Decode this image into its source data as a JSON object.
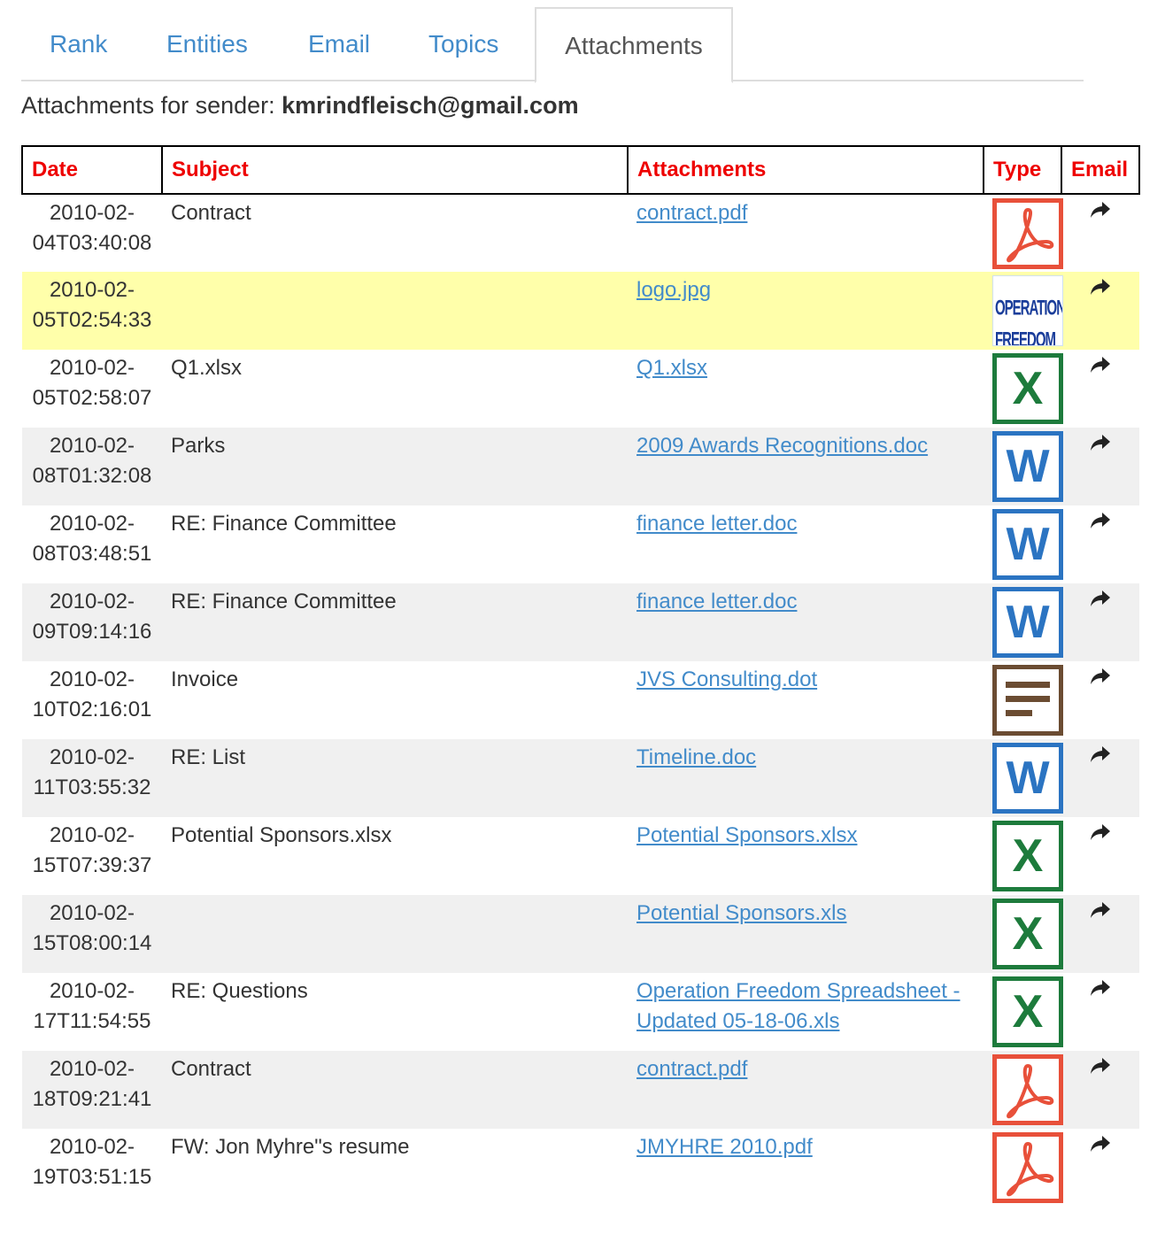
{
  "tabs": [
    {
      "label": "Rank"
    },
    {
      "label": "Entities"
    },
    {
      "label": "Email"
    },
    {
      "label": "Topics"
    },
    {
      "label": "Attachments",
      "active": true
    }
  ],
  "sender": {
    "prefix": "Attachments for sender:",
    "email": "kmrindfleisch@gmail.com"
  },
  "table": {
    "headers": {
      "date": "Date",
      "subject": "Subject",
      "attachments": "Attachments",
      "type": "Type",
      "email": "Email"
    },
    "rows": [
      {
        "date_line1": "2010-02-",
        "date_line2": "04T03:40:08",
        "subject": "Contract",
        "attachment": "contract.pdf",
        "type_icon": "pdf-icon"
      },
      {
        "date_line1": "2010-02-",
        "date_line2": "05T02:54:33",
        "subject": "",
        "attachment": "logo.jpg",
        "type_icon": "image-thumbnail",
        "thumb_text": [
          "OPERATION",
          "FREEDOM"
        ],
        "highlighted": true
      },
      {
        "date_line1": "2010-02-",
        "date_line2": "05T02:58:07",
        "subject": "Q1.xlsx",
        "attachment": "Q1.xlsx",
        "type_icon": "excel-icon"
      },
      {
        "date_line1": "2010-02-",
        "date_line2": "08T01:32:08",
        "subject": "Parks",
        "attachment": "2009 Awards Recognitions.doc",
        "type_icon": "word-icon"
      },
      {
        "date_line1": "2010-02-",
        "date_line2": "08T03:48:51",
        "subject": "RE: Finance Committee",
        "attachment": "finance letter.doc",
        "type_icon": "word-icon"
      },
      {
        "date_line1": "2010-02-",
        "date_line2": "09T09:14:16",
        "subject": "RE: Finance Committee",
        "attachment": "finance letter.doc",
        "type_icon": "word-icon"
      },
      {
        "date_line1": "2010-02-",
        "date_line2": "10T02:16:01",
        "subject": "Invoice",
        "attachment": "JVS Consulting.dot",
        "type_icon": "text-document-icon"
      },
      {
        "date_line1": "2010-02-",
        "date_line2": "11T03:55:32",
        "subject": "RE: List",
        "attachment": "Timeline.doc",
        "type_icon": "word-icon"
      },
      {
        "date_line1": "2010-02-",
        "date_line2": "15T07:39:37",
        "subject": "Potential Sponsors.xlsx",
        "attachment": "Potential Sponsors.xlsx",
        "type_icon": "excel-icon"
      },
      {
        "date_line1": "2010-02-",
        "date_line2": "15T08:00:14",
        "subject": "",
        "attachment": "Potential Sponsors.xls",
        "type_icon": "excel-icon"
      },
      {
        "date_line1": "2010-02-",
        "date_line2": "17T11:54:55",
        "subject": "RE: Questions",
        "attachment": "Operation Freedom Spreadsheet - Updated 05-18-06.xls",
        "type_icon": "excel-icon"
      },
      {
        "date_line1": "2010-02-",
        "date_line2": "18T09:21:41",
        "subject": "Contract",
        "attachment": "contract.pdf",
        "type_icon": "pdf-icon"
      },
      {
        "date_line1": "2010-02-",
        "date_line2": "19T03:51:15",
        "subject": "FW: Jon Myhre\"s resume",
        "attachment": "JMYHRE 2010.pdf",
        "type_icon": "pdf-icon"
      }
    ]
  },
  "icons": {
    "excel_letter": "X",
    "word_letter": "W",
    "email_action": "share-arrow-icon"
  },
  "colors": {
    "link": "#428bca",
    "header_text": "#ee0000",
    "highlight_row": "#ffffaa",
    "stripe_row": "#f0f0f0",
    "pdf": "#e8503a",
    "excel": "#1d7b3c",
    "word": "#2b74c2",
    "dot": "#6b4c32"
  }
}
